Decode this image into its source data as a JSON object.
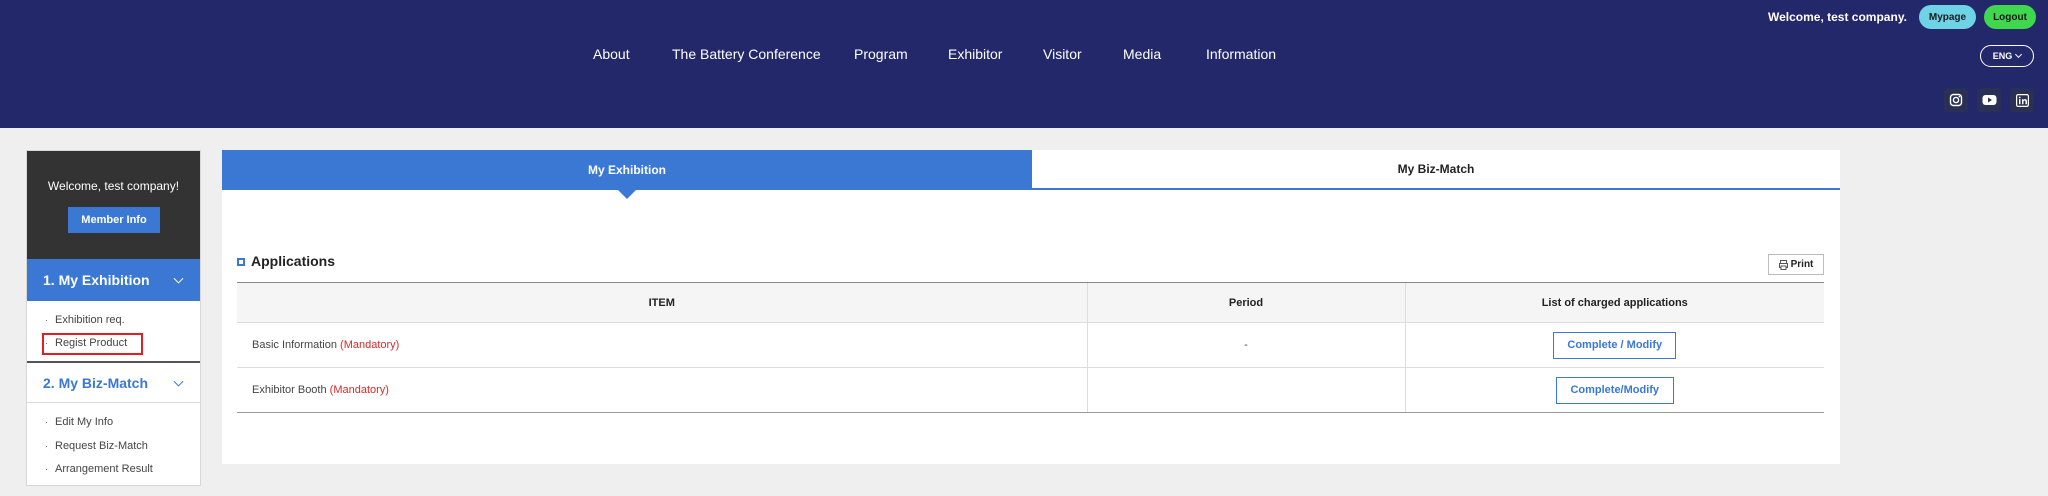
{
  "header": {
    "welcome": "Welcome, test company.",
    "mypage_label": "Mypage",
    "logout_label": "Logout",
    "nav": [
      "About",
      "The Battery Conference",
      "Program",
      "Exhibitor",
      "Visitor",
      "Media",
      "Information"
    ],
    "lang_label": "ENG",
    "social": [
      "instagram-icon",
      "youtube-icon",
      "linkedin-icon"
    ]
  },
  "sidebar": {
    "welcome": "Welcome, test company!",
    "member_info_label": "Member Info",
    "section1": {
      "title": "1.  My Exhibition",
      "items": [
        "Exhibition req.",
        "Regist Product"
      ]
    },
    "section2": {
      "title": "2.  My Biz-Match",
      "items": [
        "Edit My Info",
        "Request Biz-Match",
        "Arrangement Result"
      ]
    },
    "bullet": "·"
  },
  "main": {
    "tabs": [
      "My Exhibition",
      "My Biz-Match"
    ],
    "section_title": "Applications",
    "print_label": "Print",
    "table": {
      "headers": [
        "ITEM",
        "Period",
        "List of charged applications"
      ],
      "rows": [
        {
          "item": "Basic Information ",
          "mandatory": "(Mandatory)",
          "period": "-",
          "action": "Complete / Modify"
        },
        {
          "item": "Exhibitor Booth ",
          "mandatory": "(Mandatory)",
          "period": "",
          "action": "Complete/Modify"
        }
      ]
    }
  },
  "colors": {
    "header_bg": "#23286b",
    "accent": "#3a78d4",
    "sidebar_top": "#333333",
    "mandatory": "#d42b2b",
    "highlight": "#e02020"
  }
}
